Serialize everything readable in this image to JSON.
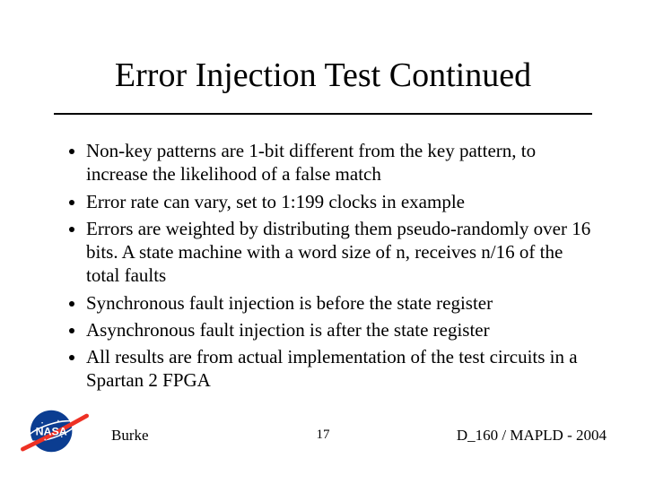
{
  "title": "Error Injection Test Continued",
  "bullets": {
    "b0": "Non-key patterns are 1-bit different from the key pattern, to increase the likelihood of a false match",
    "b1": "Error rate can vary, set to 1:199 clocks in example",
    "b2": "Errors are weighted by distributing them pseudo-randomly over 16 bits. A state machine with a word size of n, receives n/16 of the total faults",
    "b3": "Synchronous fault injection is before the state register",
    "b4": "Asynchronous fault injection is after the state register",
    "b5": "All results are from actual implementation of the test circuits in a Spartan 2 FPGA"
  },
  "footer": {
    "author": "Burke",
    "page": "17",
    "right": "D_160 / MAPLD - 2004"
  },
  "logo": {
    "text": "NASA"
  }
}
